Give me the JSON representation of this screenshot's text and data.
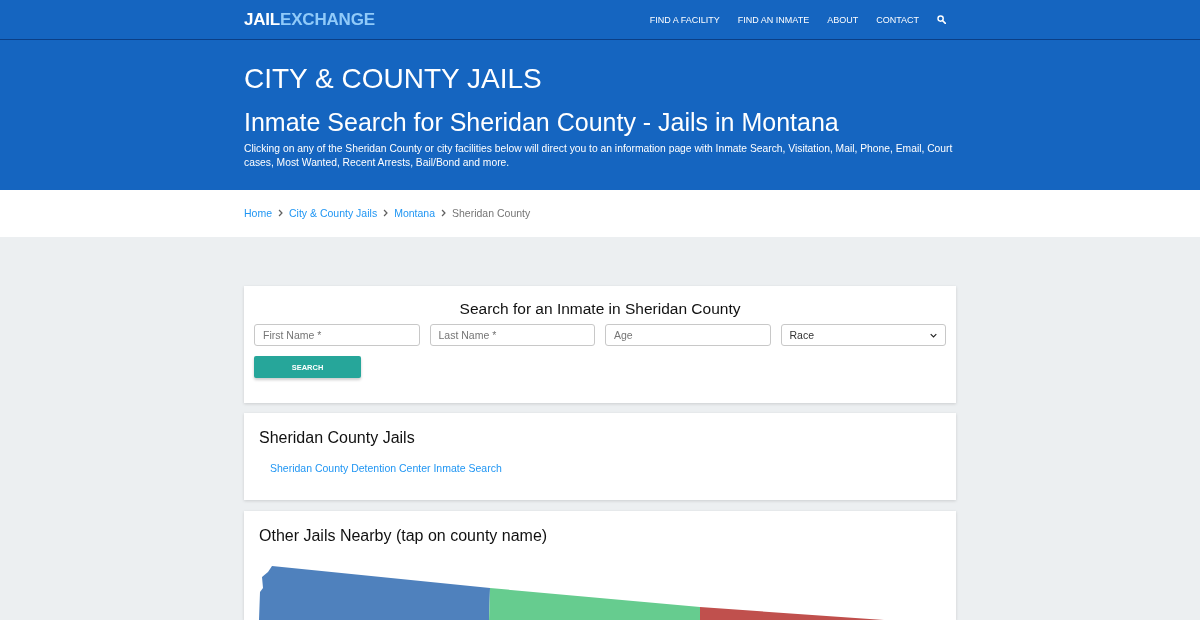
{
  "nav": {
    "logo": {
      "primary": "JAIL",
      "accent": "EXCHANGE"
    },
    "links": [
      "FIND A FACILITY",
      "FIND AN INMATE",
      "ABOUT",
      "CONTACT"
    ]
  },
  "hero": {
    "category": "CITY & COUNTY JAILS",
    "title": "Inmate Search for Sheridan County - Jails in Montana",
    "description": "Clicking on any of the Sheridan County or city facilities below will direct you to an information page with Inmate Search, Visitation, Mail, Phone, Email, Court cases, Most Wanted, Recent Arrests, Bail/Bond and more."
  },
  "breadcrumb": [
    {
      "label": "Home",
      "current": false
    },
    {
      "label": "City & County Jails",
      "current": false
    },
    {
      "label": "Montana",
      "current": false
    },
    {
      "label": "Sheridan County",
      "current": true
    }
  ],
  "search_form": {
    "title": "Search for an Inmate in Sheridan County",
    "fields": [
      {
        "kind": "text",
        "placeholder": "First Name *"
      },
      {
        "kind": "text",
        "placeholder": "Last Name *"
      },
      {
        "kind": "text",
        "placeholder": "Age"
      },
      {
        "kind": "select",
        "value": "Race"
      }
    ],
    "button": "SEARCH"
  },
  "county_jails": {
    "title": "Sheridan County Jails",
    "links": [
      "Sheridan County Detention Center Inmate Search"
    ]
  },
  "nearby": {
    "title": "Other Jails Nearby (tap on county name)"
  }
}
